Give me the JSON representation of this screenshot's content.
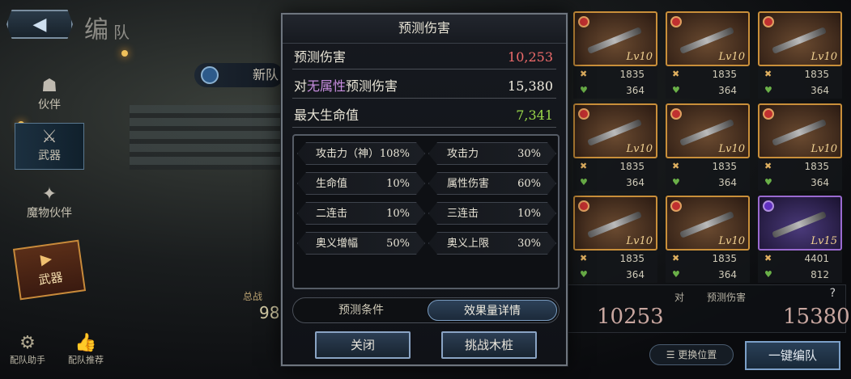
{
  "header": {
    "title_main": "编",
    "title_sub": "队",
    "back_icon": "back-arrow-icon"
  },
  "sidebar": {
    "items": [
      {
        "label": "伙伴",
        "icon": "partner-icon"
      },
      {
        "label": "武器",
        "icon": "crossed-swords-icon"
      },
      {
        "label": "魔物伙伴",
        "icon": "monster-icon"
      }
    ],
    "active_badge_label": "武器"
  },
  "bottom_left": {
    "assistant": "配队助手",
    "recommend": "配队推荐"
  },
  "team": {
    "name": "新队"
  },
  "total_power": {
    "label": "总战",
    "value": "98"
  },
  "weapons": [
    {
      "lv": "Lv10",
      "atk": "1835",
      "hp": "364",
      "rarity": "gold"
    },
    {
      "lv": "Lv10",
      "atk": "1835",
      "hp": "364",
      "rarity": "gold"
    },
    {
      "lv": "Lv10",
      "atk": "1835",
      "hp": "364",
      "rarity": "gold"
    },
    {
      "lv": "Lv10",
      "atk": "1835",
      "hp": "364",
      "rarity": "gold"
    },
    {
      "lv": "Lv10",
      "atk": "1835",
      "hp": "364",
      "rarity": "gold"
    },
    {
      "lv": "Lv10",
      "atk": "1835",
      "hp": "364",
      "rarity": "gold"
    },
    {
      "lv": "Lv10",
      "atk": "1835",
      "hp": "364",
      "rarity": "gold"
    },
    {
      "lv": "Lv10",
      "atk": "1835",
      "hp": "364",
      "rarity": "gold"
    },
    {
      "lv": "Lv15",
      "atk": "4401",
      "hp": "812",
      "rarity": "purple"
    }
  ],
  "bottom_panel": {
    "left_value": "10253",
    "right_prefix": "对",
    "right_label": "预测伤害",
    "right_value": "15380",
    "help": "?"
  },
  "buttons": {
    "swap": "更换位置",
    "one_click": "一键编队"
  },
  "modal": {
    "title": "预测伤害",
    "predicted_damage_label": "预测伤害",
    "predicted_damage_value": "10,253",
    "vs_prefix": "对",
    "vs_highlight": "无属性",
    "vs_suffix": "预测伤害",
    "vs_value": "15,380",
    "max_hp_label": "最大生命值",
    "max_hp_value": "7,341",
    "buffs": [
      {
        "name": "攻击力（神）",
        "value": "108%"
      },
      {
        "name": "攻击力",
        "value": "30%"
      },
      {
        "name": "生命值",
        "value": "10%"
      },
      {
        "name": "属性伤害",
        "value": "60%"
      },
      {
        "name": "二连击",
        "value": "10%"
      },
      {
        "name": "三连击",
        "value": "10%"
      },
      {
        "name": "奥义增幅",
        "value": "50%"
      },
      {
        "name": "奥义上限",
        "value": "30%"
      }
    ],
    "tabs": [
      "预测条件",
      "效果量详情"
    ],
    "close_label": "关闭",
    "challenge_label": "挑战木桩",
    "colors": {
      "damage": "#ef6b6b",
      "vs": "#f0ece0",
      "hp": "#9ad84a",
      "highlight": "#c88ee0"
    }
  }
}
